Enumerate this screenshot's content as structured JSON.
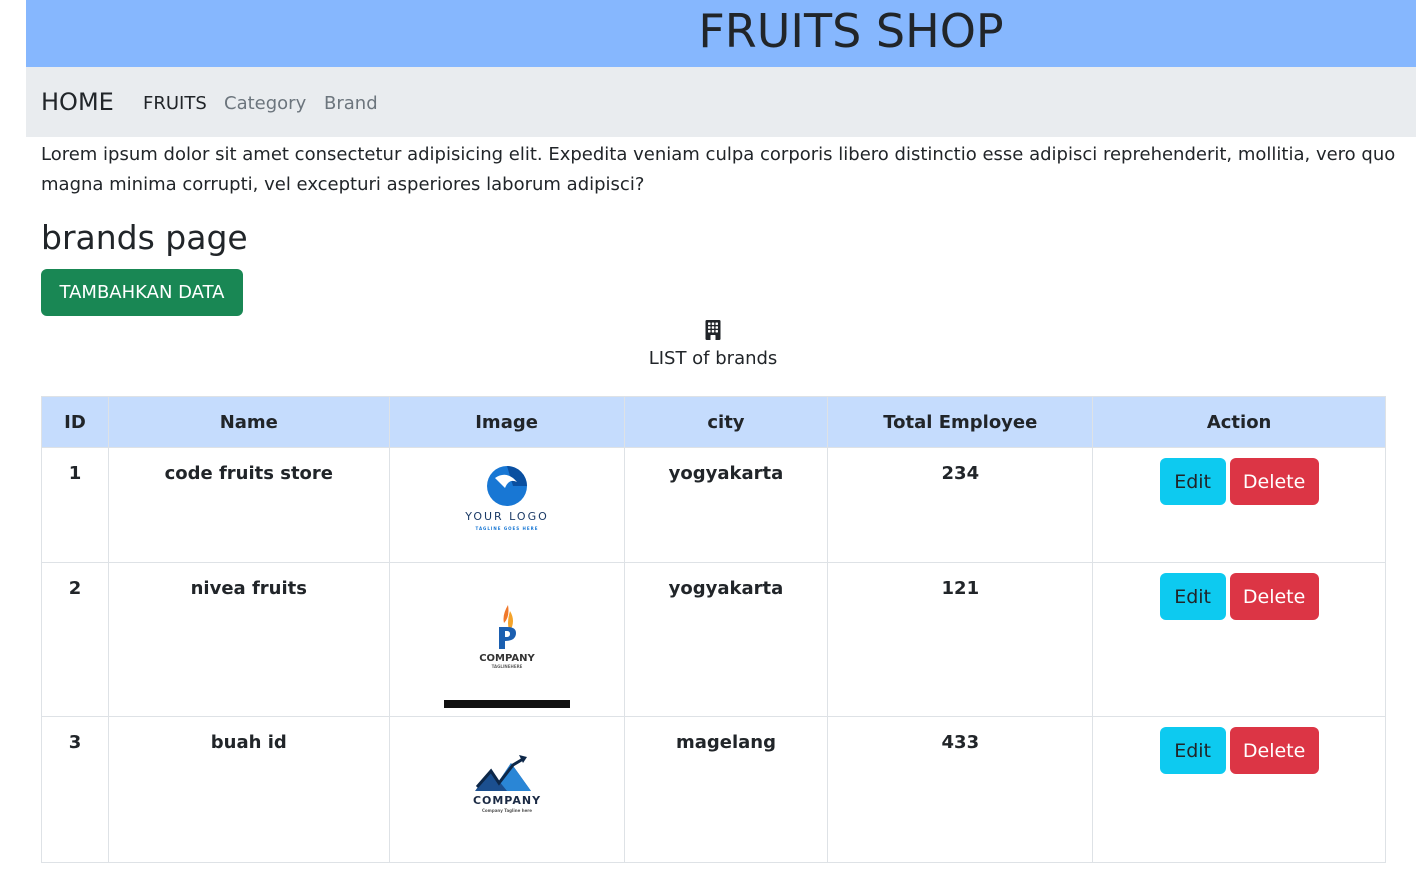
{
  "header": {
    "title": "FRUITS SHOP"
  },
  "nav": {
    "brand": "HOME",
    "links": [
      "FRUITS",
      "Category",
      "Brand"
    ]
  },
  "intro": "Lorem ipsum dolor sit amet consectetur adipisicing elit. Expedita veniam culpa corporis libero distinctio esse adipisci reprehenderit, mollitia, vero quo magna minima corrupti, vel excepturi asperiores laborum adipisci?",
  "page": {
    "title": "brands page",
    "add_button": "TAMBAHKAN DATA",
    "caption": "LIST of brands",
    "caption_icon": "building-icon"
  },
  "table": {
    "headers": [
      "ID",
      "Name",
      "Image",
      "city",
      "Total Employee",
      "Action"
    ],
    "rows": [
      {
        "id": "1",
        "name": "code fruits store",
        "city": "yogyakarta",
        "employees": "234",
        "logo_text": "YOUR LOGO",
        "logo_sub": "TAGLINE GOES HERE"
      },
      {
        "id": "2",
        "name": "nivea fruits",
        "city": "yogyakarta",
        "employees": "121",
        "logo_text": "COMPANY",
        "logo_sub": "TAGLINEHERE"
      },
      {
        "id": "3",
        "name": "buah id",
        "city": "magelang",
        "employees": "433",
        "logo_text": "COMPANY",
        "logo_sub": "Company Tagline here"
      }
    ],
    "edit_label": "Edit",
    "delete_label": "Delete"
  },
  "colors": {
    "header_bg": "#86b7fe",
    "nav_bg": "#e9ecef",
    "success": "#198754",
    "info": "#0dcaf0",
    "danger": "#dc3545",
    "table_head": "#c5dcfd"
  }
}
